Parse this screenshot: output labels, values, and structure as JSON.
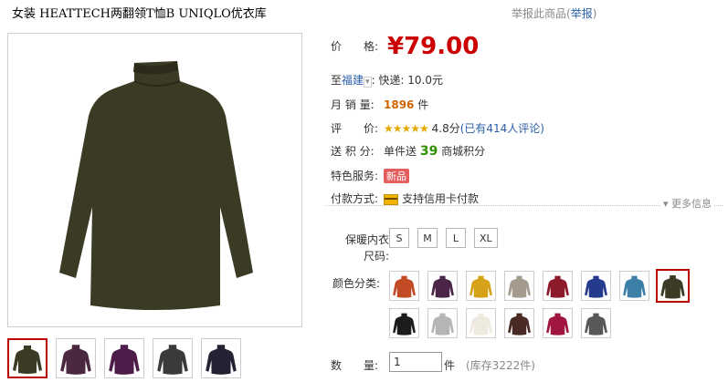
{
  "header": {
    "title": "女装 HEATTECH两翻领T恤B UNIQLO优衣库",
    "report_text": "举报此商品(",
    "report_link": "举报",
    "report_close": ")"
  },
  "product": {
    "main_color": "#3b3a24",
    "thumbnails": [
      {
        "name": "thumb-olive-sweater",
        "color": "#3b3a24"
      },
      {
        "name": "thumb-purple-set",
        "color": "#4a2840"
      },
      {
        "name": "thumb-purple-fabric",
        "color": "#4e1c49"
      },
      {
        "name": "thumb-dark-set",
        "color": "#3a3a3a"
      },
      {
        "name": "thumb-model",
        "color": "#222233"
      }
    ]
  },
  "info": {
    "price_label": "价　　格:",
    "price": "¥79.00",
    "ship_prefix": "至",
    "ship_region": "福建",
    "ship_text": ": 快递: 10.0元",
    "sales_label": "月 销 量:",
    "sales_value": "1896",
    "sales_unit": "件",
    "rating_label": "评　　价:",
    "rating_stars": "★★★★★",
    "rating_score": "4.8分",
    "rating_reviews": "(已有414人评论)",
    "points_label": "送 积 分:",
    "points_prefix": "单件送",
    "points_value": "39",
    "points_suffix": "商城积分",
    "service_label": "特色服务:",
    "service_badge": "新品",
    "payment_label": "付款方式:",
    "payment_text": "支持信用卡付款",
    "more_info": "▾ 更多信息"
  },
  "options": {
    "size_label": "保暖内衣尺码:",
    "sizes": [
      "S",
      "M",
      "L",
      "XL"
    ],
    "color_label": "颜色分类:",
    "colors": [
      "#c24a24",
      "#4b2547",
      "#d6a21a",
      "#a49a8e",
      "#8c1a2b",
      "#243a8c",
      "#3c7fa7",
      "#3b3a24",
      "#1c1c1c",
      "#b5b5b5",
      "#efeadf",
      "#4a2a24",
      "#a0163e",
      "#585858"
    ],
    "selected_color_index": 7
  },
  "quantity": {
    "label": "数　　量:",
    "value": "1",
    "unit": "件",
    "stock": "(库存3222件)"
  }
}
